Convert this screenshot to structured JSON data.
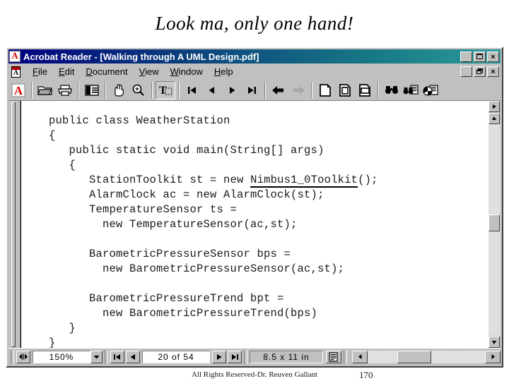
{
  "slide": {
    "title": "Look ma, only one hand!",
    "footer": "All Rights Reserved-Dr. Reuven Gallant",
    "page_number": "170"
  },
  "window": {
    "title": "Acrobat Reader - [Walking through A UML Design.pdf]",
    "app_icon": "acrobat-icon",
    "controls": {
      "minimize": "_",
      "maximize": "□",
      "close": "×"
    },
    "mdi_controls": {
      "minimize": "_",
      "restore": "□",
      "close": "×"
    }
  },
  "menu": {
    "doc_icon": "acrobat-document-icon",
    "items": [
      {
        "label": "File",
        "mnemonic": "F"
      },
      {
        "label": "Edit",
        "mnemonic": "E"
      },
      {
        "label": "Document",
        "mnemonic": "D"
      },
      {
        "label": "View",
        "mnemonic": "V"
      },
      {
        "label": "Window",
        "mnemonic": "W"
      },
      {
        "label": "Help",
        "mnemonic": "H"
      }
    ]
  },
  "toolbar": {
    "buttons": [
      {
        "name": "adobe-logo-icon",
        "tip": "Adobe Online"
      },
      {
        "name": "open-folder-icon",
        "tip": "Open"
      },
      {
        "name": "printer-icon",
        "tip": "Print"
      },
      {
        "name": "show-hide-navpane-icon",
        "tip": "Show/Hide Navigation Pane"
      },
      {
        "name": "hand-tool-icon",
        "tip": "Hand Tool"
      },
      {
        "name": "zoom-in-tool-icon",
        "tip": "Zoom In Tool"
      },
      {
        "name": "text-select-tool-icon",
        "tip": "Text Select Tool",
        "pressed": true
      },
      {
        "name": "first-page-icon",
        "tip": "First Page"
      },
      {
        "name": "previous-page-icon",
        "tip": "Previous Page"
      },
      {
        "name": "next-page-icon",
        "tip": "Next Page"
      },
      {
        "name": "last-page-icon",
        "tip": "Last Page"
      },
      {
        "name": "go-back-icon",
        "tip": "Go to Previous View"
      },
      {
        "name": "go-forward-icon",
        "tip": "Go to Next View",
        "disabled": true
      },
      {
        "name": "actual-size-icon",
        "tip": "Actual Size"
      },
      {
        "name": "fit-page-icon",
        "tip": "Fit in Window"
      },
      {
        "name": "fit-width-icon",
        "tip": "Fit Width"
      },
      {
        "name": "find-icon",
        "tip": "Find"
      },
      {
        "name": "search-icon",
        "tip": "Search"
      },
      {
        "name": "search-results-icon",
        "tip": "Search Results"
      }
    ]
  },
  "document": {
    "code_lines": [
      {
        "text": "  public class WeatherStation"
      },
      {
        "text": "  {"
      },
      {
        "text": "     public static void main(String[] args)"
      },
      {
        "text": "     {"
      },
      {
        "text": "        StationToolkit st = new ",
        "highlight": "Nimbus1_0Toolkit",
        "after": "();"
      },
      {
        "text": "        AlarmClock ac = new AlarmClock(st);"
      },
      {
        "text": "        TemperatureSensor ts ="
      },
      {
        "text": "          new TemperatureSensor(ac,st);"
      },
      {
        "text": ""
      },
      {
        "text": "        BarometricPressureSensor bps ="
      },
      {
        "text": "          new BarometricPressureSensor(ac,st);"
      },
      {
        "text": ""
      },
      {
        "text": "        BarometricPressureTrend bpt ="
      },
      {
        "text": "          new BarometricPressureTrend(bps)"
      },
      {
        "text": "     }"
      },
      {
        "text": "  }"
      }
    ]
  },
  "statusbar": {
    "zoom_value": "150%",
    "page_value": "20 of 54",
    "page_size": "8.5 x 11 in",
    "first_page_icon": "first-page-icon",
    "prev_page_icon": "previous-page-icon",
    "next_page_icon": "next-page-icon",
    "last_page_icon": "last-page-icon",
    "resize_icon": "page-layout-icon",
    "hscroll_left_icon": "scroll-left-icon",
    "hscroll_right_icon": "scroll-right-icon"
  }
}
